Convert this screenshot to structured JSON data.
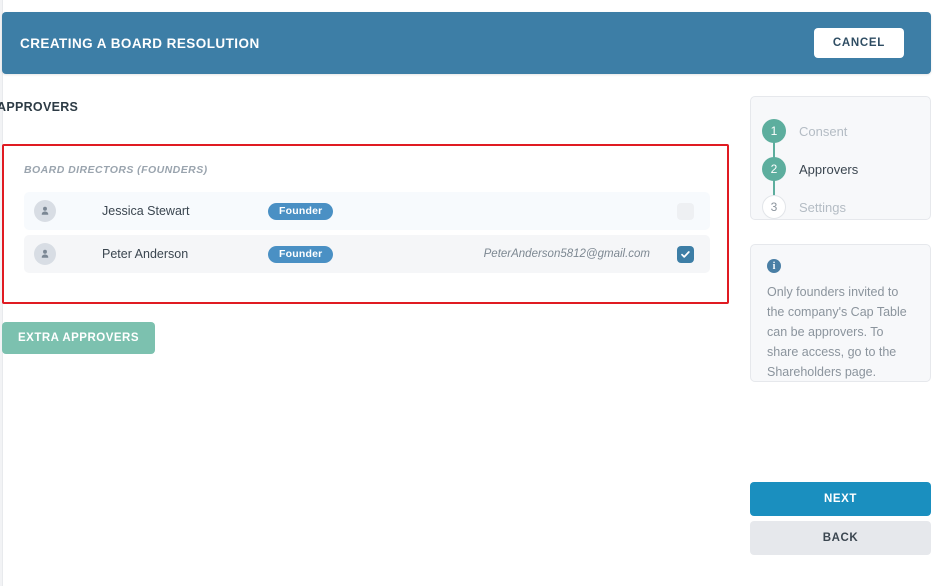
{
  "header": {
    "title": "CREATING A BOARD RESOLUTION",
    "cancel_label": "CANCEL",
    "background_color": "#3d7ea6"
  },
  "main": {
    "section_title": "APPROVERS",
    "group_label": "BOARD DIRECTORS (FOUNDERS)",
    "approvers": [
      {
        "name": "Jessica Stewart",
        "badge": "Founder",
        "email": "",
        "checked": false,
        "avatar_icon": "person-avatar-icon"
      },
      {
        "name": "Peter Anderson",
        "badge": "Founder",
        "email": "PeterAnderson5812@gmail.com",
        "checked": true,
        "avatar_icon": "person-avatar-icon"
      }
    ],
    "extra_approvers_label": "EXTRA APPROVERS",
    "highlight_color": "#e01b22",
    "badge_color": "#4a90c4",
    "extra_approvers_color": "#7cc1af"
  },
  "sidebar": {
    "steps": [
      {
        "number": "1",
        "label": "Consent",
        "state": "done"
      },
      {
        "number": "2",
        "label": "Approvers",
        "state": "current"
      },
      {
        "number": "3",
        "label": "Settings",
        "state": "todo"
      }
    ],
    "info": {
      "icon": "info-icon",
      "text": "Only founders invited to the company's Cap Table can be approvers. To share access, go to the Shareholders page."
    },
    "next_label": "NEXT",
    "back_label": "BACK",
    "step_done_color": "#5dae9e",
    "next_color": "#1a8fbf"
  }
}
